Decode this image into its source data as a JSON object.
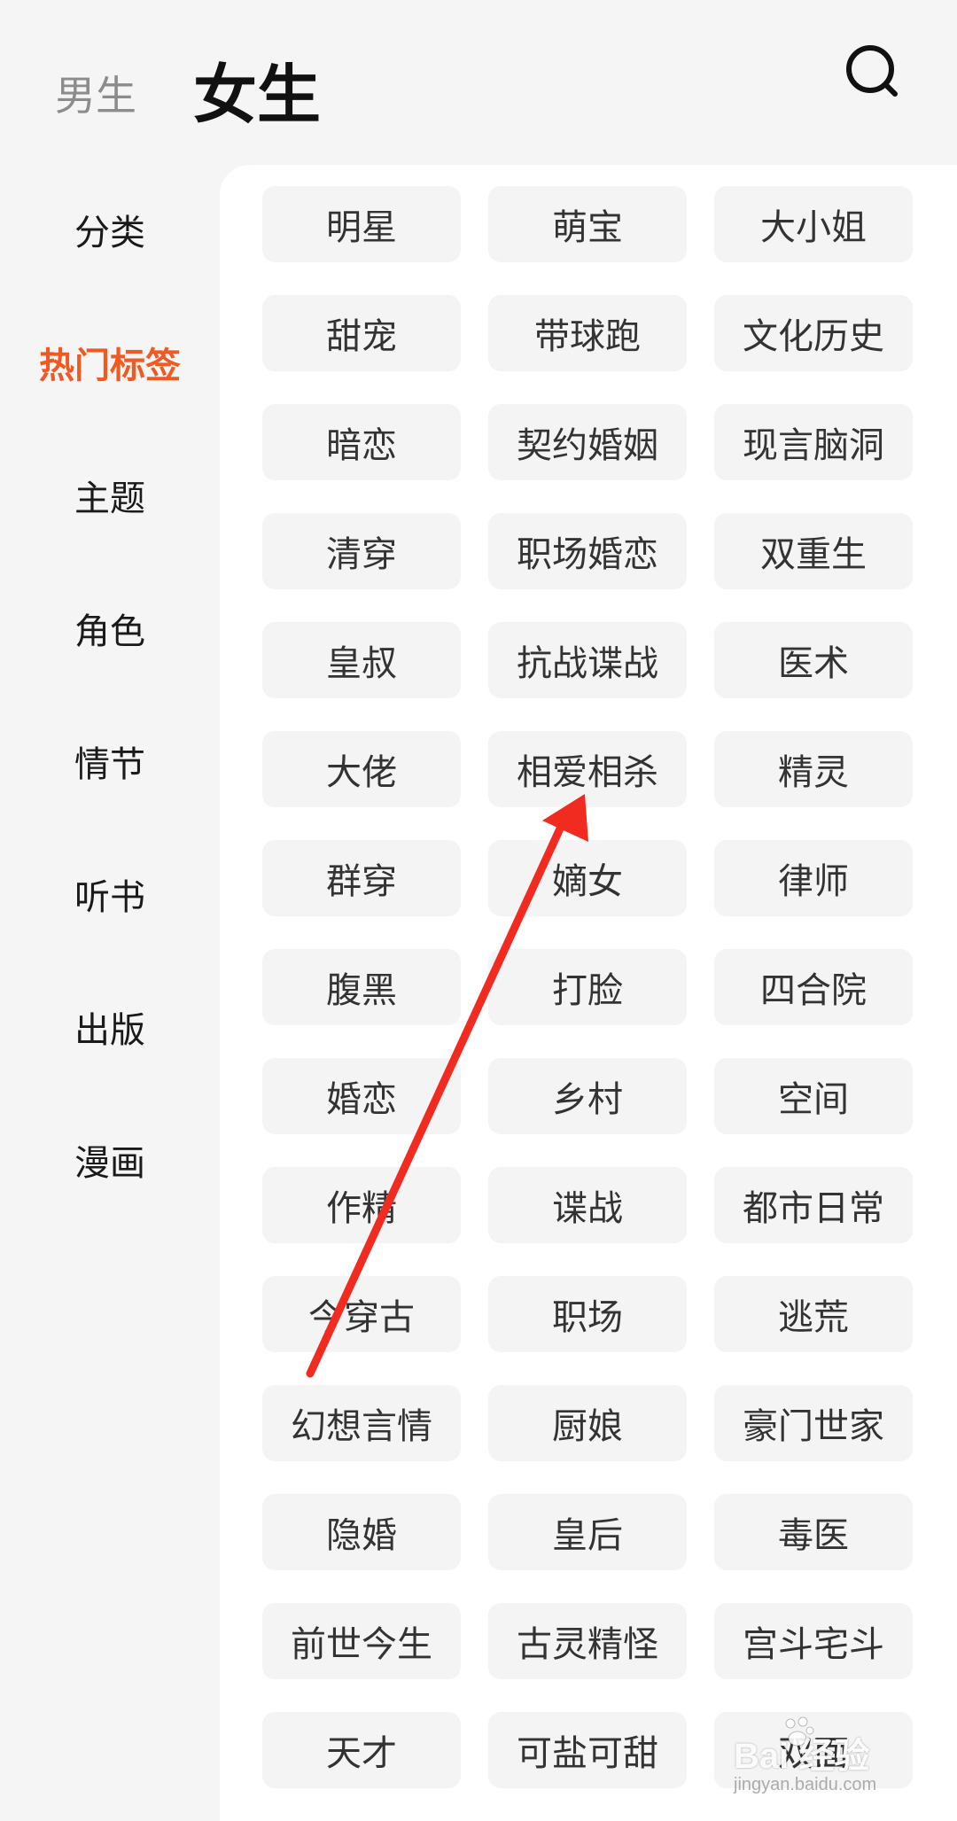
{
  "header": {
    "male_tab": "男生",
    "female_tab": "女生",
    "search_icon": "search-icon"
  },
  "sidebar": {
    "items": [
      "分类",
      "热门标签",
      "主题",
      "角色",
      "情节",
      "听书",
      "出版",
      "漫画"
    ],
    "active": "热门标签"
  },
  "tags": [
    "明星",
    "萌宝",
    "大小姐",
    "甜宠",
    "带球跑",
    "文化历史",
    "暗恋",
    "契约婚姻",
    "现言脑洞",
    "清穿",
    "职场婚恋",
    "双重生",
    "皇叔",
    "抗战谍战",
    "医术",
    "大佬",
    "相爱相杀",
    "精灵",
    "群穿",
    "嫡女",
    "律师",
    "腹黑",
    "打脸",
    "四合院",
    "婚恋",
    "乡村",
    "空间",
    "作精",
    "谍战",
    "都市日常",
    "今穿古",
    "职场",
    "逃荒",
    "幻想言情",
    "厨娘",
    "豪门世家",
    "隐婚",
    "皇后",
    "毒医",
    "前世今生",
    "古灵精怪",
    "宫斗宅斗",
    "天才",
    "可盐可甜",
    "双面"
  ],
  "watermark": {
    "main": "Bai 经验",
    "sub": "jingyan.baidu.com"
  },
  "colors": {
    "accent": "#f05a22",
    "arrow": "#f22b21",
    "background": "#f5f5f5",
    "tag_bg": "#f4f4f4"
  }
}
